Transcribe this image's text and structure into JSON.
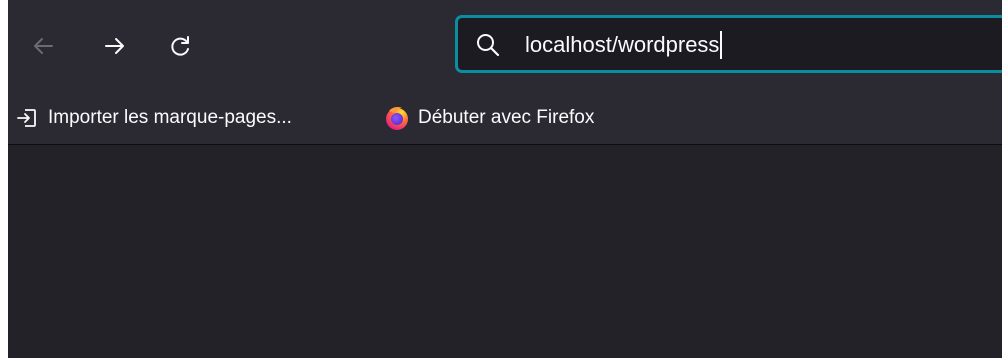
{
  "toolbar": {
    "back_icon": "arrow-left-icon",
    "forward_icon": "arrow-right-icon",
    "reload_icon": "reload-icon"
  },
  "urlbar": {
    "search_icon": "search-icon",
    "value": "localhost/wordpress"
  },
  "bookmarks": {
    "items": [
      {
        "label": "Importer les marque-pages...",
        "icon": "import-icon"
      },
      {
        "label": "Débuter avec Firefox",
        "icon": "firefox-icon"
      }
    ]
  },
  "colors": {
    "toolbar_bg": "#2b2a33",
    "urlbar_bg": "#1c1b22",
    "focus_ring": "#0c8ea1",
    "text": "#fbfbfe",
    "content_bg": "#232229"
  }
}
